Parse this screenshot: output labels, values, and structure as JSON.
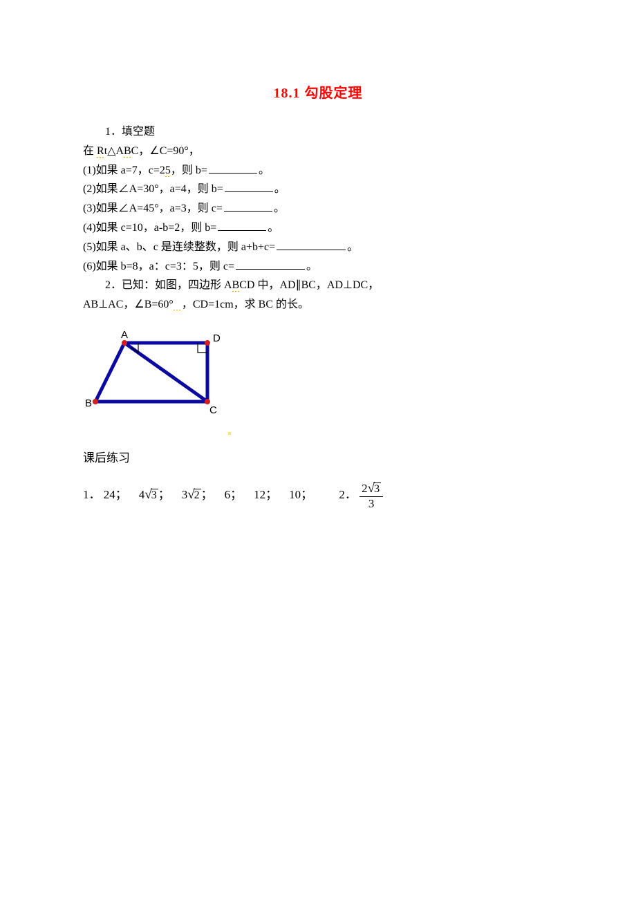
{
  "title": "18.1 勾股定理",
  "q1": {
    "heading": "1．填空题",
    "premise": "在 Rt△ABC，∠C=90°，",
    "parts": [
      "(1)如果 a=7，c=25，则 b=",
      "(2)如果∠A=30°，a=4，则 b=",
      "(3)如果∠A=45°，a=3，则 c=",
      "(4)如果 c=10，a-b=2，则 b=",
      "(5)如果 a、b、c 是连续整数，则 a+b+c=",
      "(6)如果 b=8，a：c=3：5，则 c="
    ],
    "end": "。"
  },
  "q2": {
    "line1_prefix": "2．已知：如图，四边形 A",
    "line1_mid": "BCD 中，AD∥BC，AD⊥DC，",
    "line2_prefix": "AB⊥AC，∠B=60°",
    "line2_suffix": "，CD=1cm，求 BC 的长。"
  },
  "figure_labels": {
    "A": "A",
    "B": "B",
    "C": "C",
    "D": "D"
  },
  "answers_header": "课后练习",
  "answers": {
    "label1": "1．",
    "a1": "24；",
    "a2_pre": "4",
    "a2_rad": "3",
    "a2_post": "；",
    "a3_pre": "3",
    "a3_rad": "2",
    "a3_post": "；",
    "a4": "6；",
    "a5": "12；",
    "a6": "10；",
    "label2": "2．",
    "frac_num_pre": "2",
    "frac_num_rad": "3",
    "frac_den": "3"
  }
}
